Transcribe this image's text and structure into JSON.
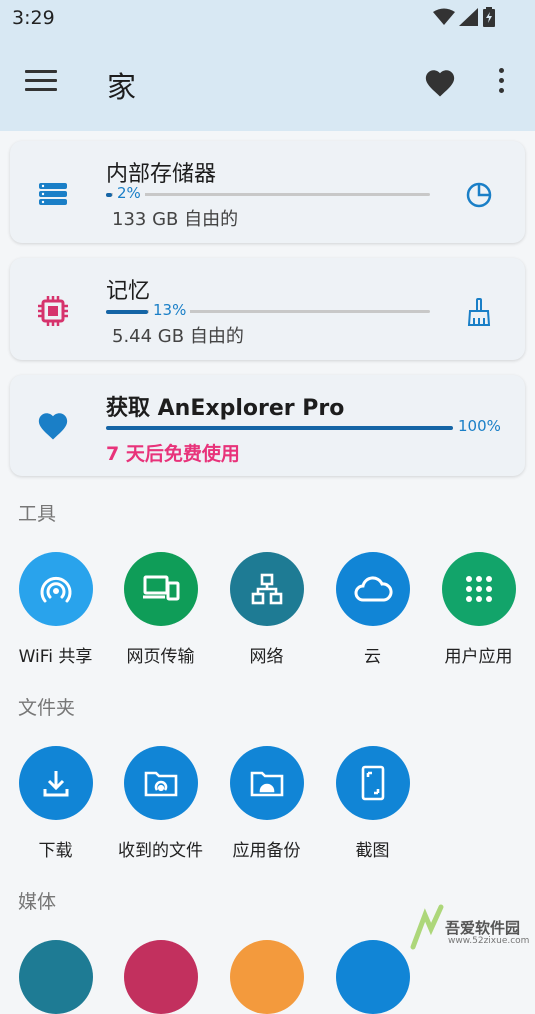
{
  "status": {
    "time": "3:29"
  },
  "appbar": {
    "title": "家"
  },
  "storage": {
    "title": "内部存储器",
    "percent": "2%",
    "used_fraction": 0.02,
    "free": "133 GB 自由的"
  },
  "memory": {
    "title": "记忆",
    "percent": "13%",
    "used_fraction": 0.13,
    "free": "5.44 GB 自由的"
  },
  "pro": {
    "title": "获取 AnExplorer Pro",
    "percent": "100%",
    "trial": "7 天后免费使用"
  },
  "sections": {
    "tools": "工具",
    "folders": "文件夹",
    "media": "媒体"
  },
  "tools": [
    {
      "label": "WiFi 共享",
      "color": "#29a3ec",
      "icon": "wifi-share-icon"
    },
    {
      "label": "网页传输",
      "color": "#0f9d58",
      "icon": "devices-icon"
    },
    {
      "label": "网络",
      "color": "#1e7b94",
      "icon": "network-icon"
    },
    {
      "label": "云",
      "color": "#1185d6",
      "icon": "cloud-icon"
    },
    {
      "label": "用户应用",
      "color": "#12a46a",
      "icon": "apps-grid-icon"
    }
  ],
  "folders": [
    {
      "label": "下载",
      "color": "#1185d6",
      "icon": "download-icon"
    },
    {
      "label": "收到的文件",
      "color": "#1185d6",
      "icon": "received-folder-icon"
    },
    {
      "label": "应用备份",
      "color": "#1185d6",
      "icon": "android-folder-icon"
    },
    {
      "label": "截图",
      "color": "#1185d6",
      "icon": "screenshot-icon"
    }
  ],
  "watermark": {
    "text": "吾爱软件园",
    "url": "www.52zixue.com"
  },
  "colors": {
    "appbar": "#d8e8f3",
    "accent": "#1565a6",
    "pink": "#e8337a",
    "memory_icon": "#d6336c"
  }
}
